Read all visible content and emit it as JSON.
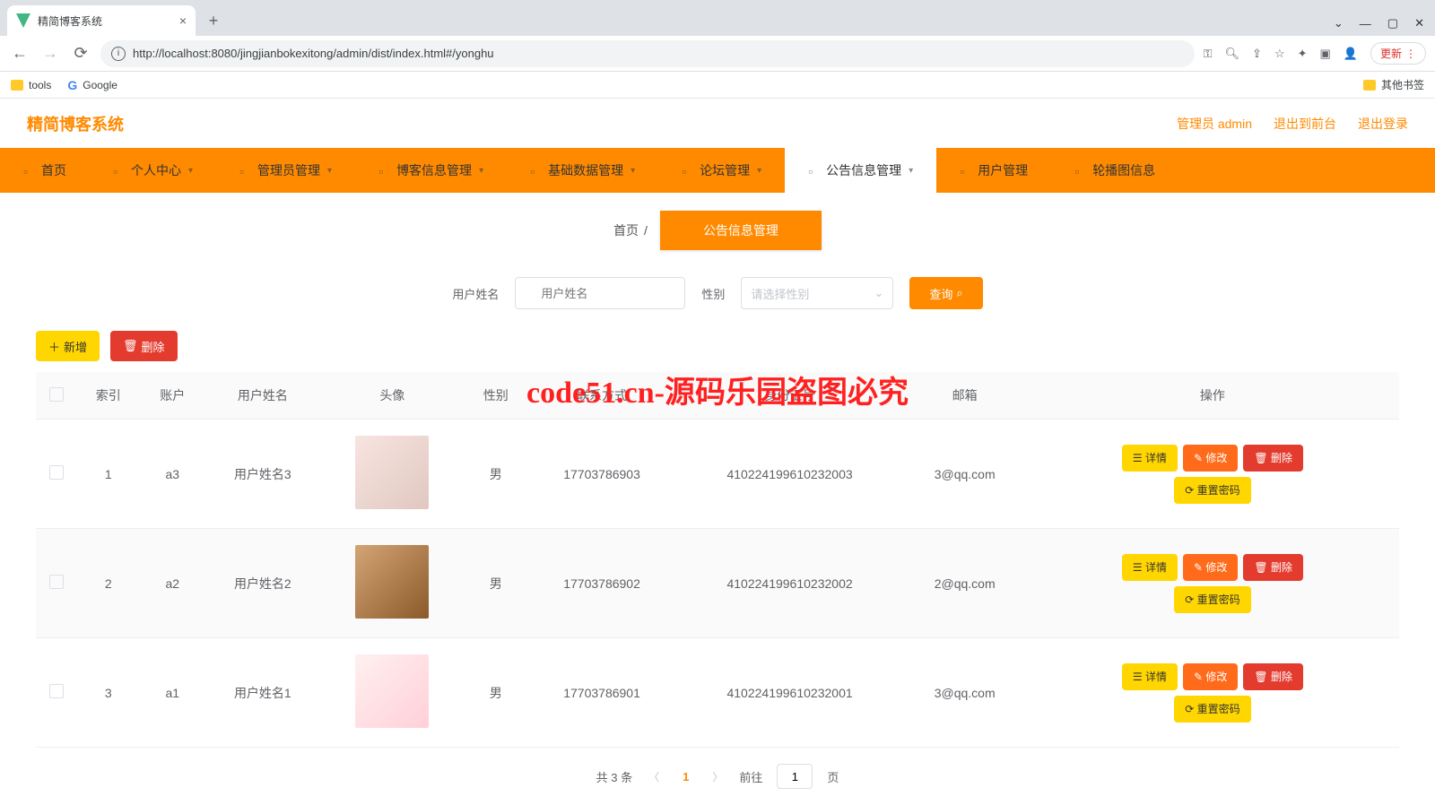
{
  "browser": {
    "tab_title": "精简博客系统",
    "url": "http://localhost:8080/jingjianbokexitong/admin/dist/index.html#/yonghu",
    "bookmarks": {
      "tools": "tools",
      "google": "Google",
      "other": "其他书签"
    },
    "update": "更新"
  },
  "header": {
    "brand": "精简博客系统",
    "admin_label": "管理员 admin",
    "to_front": "退出到前台",
    "logout": "退出登录"
  },
  "nav": {
    "items": [
      {
        "label": "首页",
        "caret": false
      },
      {
        "label": "个人中心",
        "caret": true
      },
      {
        "label": "管理员管理",
        "caret": true
      },
      {
        "label": "博客信息管理",
        "caret": true
      },
      {
        "label": "基础数据管理",
        "caret": true
      },
      {
        "label": "论坛管理",
        "caret": true
      },
      {
        "label": "公告信息管理",
        "caret": true,
        "active": true
      },
      {
        "label": "用户管理",
        "caret": false
      },
      {
        "label": "轮播图信息",
        "caret": false
      }
    ]
  },
  "breadcrumb": {
    "home": "首页",
    "sep": "/",
    "current": "公告信息管理"
  },
  "filter": {
    "name_label": "用户姓名",
    "name_placeholder": "用户姓名",
    "gender_label": "性别",
    "gender_placeholder": "请选择性别",
    "query": "查询"
  },
  "actions": {
    "add": "新增",
    "delete": "删除"
  },
  "table": {
    "columns": [
      "",
      "索引",
      "账户",
      "用户姓名",
      "头像",
      "性别",
      "联系方式",
      "身份证号",
      "邮箱",
      "操作"
    ],
    "ops": {
      "detail": "详情",
      "edit": "修改",
      "delete": "删除",
      "reset": "重置密码"
    },
    "rows": [
      {
        "idx": "1",
        "account": "a3",
        "name": "用户姓名3",
        "gender": "男",
        "phone": "17703786903",
        "idnum": "410224199610232003",
        "email": "3@qq.com",
        "av": "av1"
      },
      {
        "idx": "2",
        "account": "a2",
        "name": "用户姓名2",
        "gender": "男",
        "phone": "17703786902",
        "idnum": "410224199610232002",
        "email": "2@qq.com",
        "av": "av2"
      },
      {
        "idx": "3",
        "account": "a1",
        "name": "用户姓名1",
        "gender": "男",
        "phone": "17703786901",
        "idnum": "410224199610232001",
        "email": "3@qq.com",
        "av": "av3"
      }
    ]
  },
  "pagination": {
    "total": "共 3 条",
    "current": "1",
    "goto": "前往",
    "goto_val": "1",
    "page_suffix": "页"
  },
  "watermark": {
    "grey": "code51.cn",
    "red": "code51.cn-源码乐园盗图必究"
  }
}
